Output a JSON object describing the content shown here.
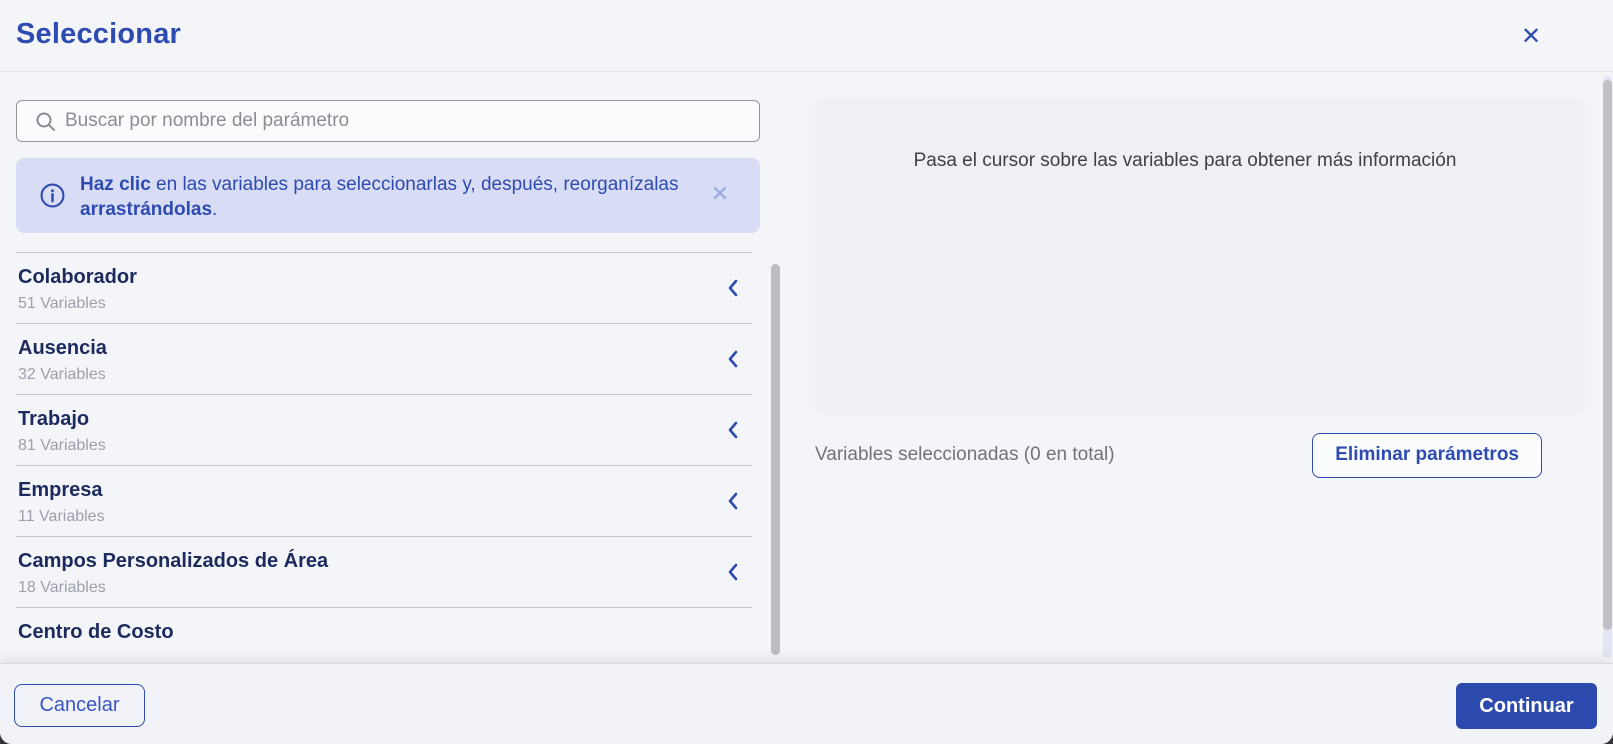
{
  "dialog": {
    "title": "Seleccionar",
    "close_glyph": "✕"
  },
  "search": {
    "placeholder": "Buscar por nombre del parámetro"
  },
  "banner": {
    "bold_lead": "Haz clic",
    "middle": " en las variables para seleccionarlas y, después, reorganízalas ",
    "bold_tail": "arrastrándolas",
    "tail_punct": ".",
    "close_glyph": "✕"
  },
  "categories": [
    {
      "name": "Colaborador",
      "count": "51 Variables"
    },
    {
      "name": "Ausencia",
      "count": "32 Variables"
    },
    {
      "name": "Trabajo",
      "count": "81 Variables"
    },
    {
      "name": "Empresa",
      "count": "11 Variables"
    },
    {
      "name": "Campos Personalizados de Área",
      "count": "18 Variables"
    },
    {
      "name": "Centro de Costo",
      "count": ""
    }
  ],
  "right_panel": {
    "hover_hint": "Pasa el cursor sobre las variables para obtener más información",
    "selected_summary": "Variables seleccionadas (0 en total)",
    "remove_params_label": "Eliminar parámetros"
  },
  "footer": {
    "cancel_label": "Cancelar",
    "continue_label": "Continuar"
  },
  "colors": {
    "accent_blue": "#2d4bb0",
    "continue_bg": "#2c49ae",
    "banner_bg": "#d8ddf5",
    "title_navy": "#1c2a5e",
    "hint_box_bg": "#eff0f3"
  }
}
